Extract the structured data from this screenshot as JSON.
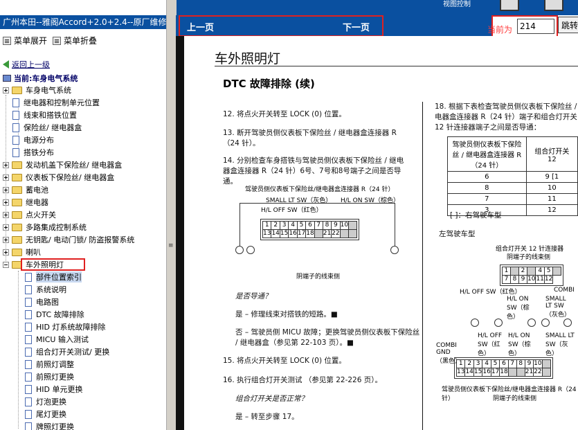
{
  "left_pane": {
    "title": "广州本田--雅阁Accord+2.0+2.4--原厂维修手册",
    "expand_label": "菜单展开",
    "collapse_label": "菜单折叠",
    "back_label": "返回上一级",
    "current_label": "当前:车身电气系统",
    "tree": [
      {
        "label": "车身电气系统",
        "type": "folder"
      },
      {
        "label": "继电器和控制单元位置",
        "type": "doc"
      },
      {
        "label": "线束和搭铁位置",
        "type": "doc"
      },
      {
        "label": "保险丝/ 继电器盒",
        "type": "doc"
      },
      {
        "label": "电源分布",
        "type": "doc"
      },
      {
        "label": "搭铁分布",
        "type": "doc"
      },
      {
        "label": "发动机盖下保险丝/ 继电器盒",
        "type": "folder"
      },
      {
        "label": "仪表板下保险丝/ 继电器盒",
        "type": "folder"
      },
      {
        "label": "蓄电池",
        "type": "folder"
      },
      {
        "label": "继电器",
        "type": "folder"
      },
      {
        "label": "点火开关",
        "type": "folder"
      },
      {
        "label": "多路集成控制系统",
        "type": "folder"
      },
      {
        "label": "无钥匙/ 电动门锁/ 防盗报警系统",
        "type": "folder"
      },
      {
        "label": "喇叭",
        "type": "folder"
      },
      {
        "label": "车外照明灯",
        "type": "folder-open"
      },
      {
        "label": "部件位置索引",
        "type": "doc"
      },
      {
        "label": "系统说明",
        "type": "doc"
      },
      {
        "label": "电路图",
        "type": "doc"
      },
      {
        "label": "DTC 故障排除",
        "type": "doc"
      },
      {
        "label": "HID 灯系统故障排除",
        "type": "doc"
      },
      {
        "label": "MICU 输入测试",
        "type": "doc"
      },
      {
        "label": "组合灯开关测试/ 更换",
        "type": "doc"
      },
      {
        "label": "前照灯调整",
        "type": "doc"
      },
      {
        "label": "前照灯更换",
        "type": "doc"
      },
      {
        "label": "HID 单元更换",
        "type": "doc"
      },
      {
        "label": "灯泡更换",
        "type": "doc"
      },
      {
        "label": "尾灯更换",
        "type": "doc"
      },
      {
        "label": "牌照灯更换",
        "type": "doc"
      }
    ]
  },
  "nav": {
    "prev_label": "上一页",
    "next_label": "下一页",
    "page_label": "当前为",
    "page_value": "214",
    "jump_label": "跳转",
    "view_ctrl_label": "视图控制"
  },
  "doc": {
    "section_title": "车外照明灯",
    "subtitle": "DTC 故障排除  (续)",
    "steps_left": [
      {
        "text": "12. 将点火开关转至 LOCK (0) 位置。"
      },
      {
        "text": "13. 断开驾驶员侧仪表板下保险丝 / 继电器盒连接器 R （24 针）。"
      },
      {
        "text": "14. 分别检查车身搭铁与驾驶员侧仪表板下保险丝 / 继电器盒连接器 R（24 针）6号、7号和8号端子之间是否导通。"
      }
    ],
    "diagram1": {
      "caption_top": "驾驶员侧仪表板下保险丝/继电器盒连接器 R（24 针）",
      "small_lt": "SMALL LT SW（灰色）",
      "hl_off": "H/L OFF SW（红色）",
      "hl_on": "H/L ON SW（棕色）",
      "row1": [
        "1",
        "2",
        "3",
        "4",
        "5",
        "6",
        "7",
        "8",
        "9",
        "10",
        ""
      ],
      "row2": [
        "13",
        "14",
        "15",
        "16",
        "17",
        "18",
        "",
        "21",
        "22",
        "",
        ""
      ],
      "caption_bottom": "阴端子的线束侧"
    },
    "q1": "是否导通？",
    "yes1": "是 – 修理线束对搭铁的短路。■",
    "no1": "否 – 驾驶员侧 MICU 故障；更换驾驶员侧仪表板下保险丝 / 继电器盒（参见第 22-103 页）。■",
    "step15": "15. 将点火开关转至 LOCK (0) 位置。",
    "step16": "16. 执行组合灯开关测试 （参见第 22-226 页）。",
    "q2": "组合灯开关是否正常？",
    "yes2": "是 – 转至步骤 17。",
    "step18": "18. 根据下表检查驾驶员侧仪表板下保险丝 / 继电器盒连接器 R（24 针）端子和组合灯开关 12 针连接器端子之间是否导通：",
    "table": {
      "head1": "驾驶员侧仪表板下保险丝 / 继电器盒连接器 R（24 针）",
      "head2": "组合灯开关 12",
      "rows": [
        [
          "6",
          "9 [1"
        ],
        [
          "8",
          "10"
        ],
        [
          "7",
          "11"
        ],
        [
          "3",
          "12"
        ]
      ]
    },
    "note": "[ ]：右驾驶车型",
    "lhd": "左驾驶车型",
    "diagram2": {
      "caption_top": "组合灯开关 12 针连接器",
      "caption_sub": "阴端子的线束侧",
      "top_row1": [
        "1",
        "",
        "2",
        "",
        "4",
        "5",
        ""
      ],
      "top_row2": [
        "7",
        "8",
        "9",
        "10",
        "11",
        "12"
      ],
      "hl_off": "H/L OFF SW（红色）",
      "hl_on": "H/L ON SW（棕色）",
      "combi": "COMBI",
      "small_lt": "SMALL LT SW（灰色）",
      "combi_gnd": "COMBI GND（黑色）",
      "hl_off2": "H/L OFF SW（红色）",
      "hl_on2": "H/L ON SW（棕色）",
      "small_lt2": "SMALL LT SW（灰色）",
      "row1": [
        "1",
        "2",
        "3",
        "4",
        "5",
        "6",
        "7",
        "8",
        "9",
        "10",
        ""
      ],
      "row2": [
        "13",
        "14",
        "15",
        "16",
        "17",
        "18",
        "",
        "",
        "21",
        "22",
        ""
      ],
      "caption_bottom": "驾驶员侧仪表板下保险丝/继电器盒连接器 R（24 针）",
      "caption_bottom2": "阴端子的线束侧"
    }
  },
  "colors": {
    "nav_blue": "#0a50a0",
    "highlight_red": "#e02020"
  }
}
